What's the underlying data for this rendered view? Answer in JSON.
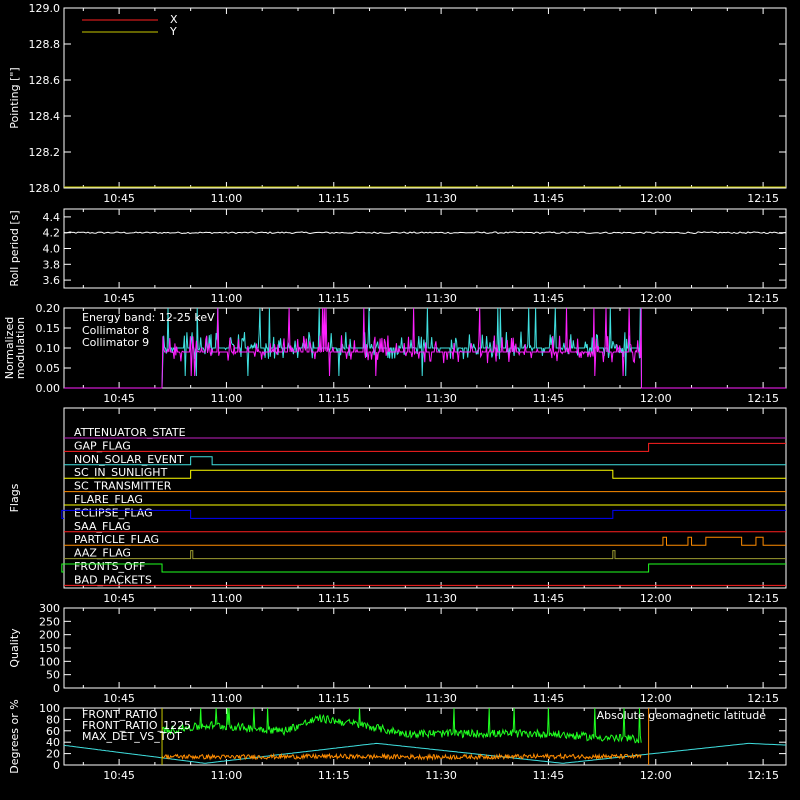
{
  "colors": {
    "background": "#000000",
    "axes": "#ffffff",
    "red": "#ff2020",
    "yellow": "#c8c800",
    "cyan": "#40e0e0",
    "magenta": "#ff20ff",
    "green": "#20ff20",
    "orange": "#ff8c00",
    "blue": "#0000ff",
    "olive": "#9b9b30",
    "purple": "#c020c0",
    "greenyellow": "#c0ff40"
  },
  "time_ticks": [
    "10:45",
    "11:00",
    "11:15",
    "11:30",
    "11:45",
    "12:00",
    "12:15"
  ],
  "chart_data": [
    {
      "id": "pointing",
      "type": "line",
      "ylabel": "Pointing [\"]",
      "ylim": [
        128.0,
        129.0
      ],
      "yticks": [
        "128.0",
        "128.2",
        "128.4",
        "128.6",
        "128.8",
        "129.0"
      ],
      "legend_position": "top-left",
      "series": [
        {
          "name": "X",
          "color": "#ff2020",
          "y": []
        },
        {
          "name": "Y",
          "color": "#c8c800",
          "y": []
        }
      ]
    },
    {
      "id": "roll-period",
      "type": "line",
      "ylabel": "Roll period [s]",
      "ylim": [
        3.5,
        4.5
      ],
      "yticks": [
        "3.6",
        "3.8",
        "4.0",
        "4.2",
        "4.4"
      ],
      "series": [
        {
          "color": "#ffffff",
          "x": [
            "10:37",
            "12:18"
          ],
          "y": [
            4.2,
            4.2
          ]
        }
      ]
    },
    {
      "id": "modulation",
      "type": "line",
      "ylabel": "Normalized modulation",
      "ylim": [
        0.0,
        0.2
      ],
      "yticks": [
        "0.00",
        "0.05",
        "0.10",
        "0.15",
        "0.20"
      ],
      "annotation": "Energy band: 12-25 keV",
      "series": [
        {
          "name": "Collimator 8",
          "color": "#40e0e0",
          "x": [
            "10:37",
            "10:51",
            "10:51",
            "11:58",
            "11:58",
            "12:18"
          ],
          "y": [
            0.0,
            0.0,
            0.1,
            0.1,
            0.0,
            0.0
          ]
        },
        {
          "name": "Collimator 9",
          "color": "#ff20ff",
          "x": [
            "10:37",
            "10:51",
            "10:51",
            "11:58",
            "11:58",
            "12:18"
          ],
          "y": [
            0.0,
            0.0,
            0.09,
            0.09,
            0.0,
            0.0
          ]
        }
      ]
    },
    {
      "id": "flags",
      "type": "line",
      "ylabel": "Flags",
      "flags": [
        {
          "name": "ATTENUATOR_STATE",
          "color": "#c020c0",
          "steps": []
        },
        {
          "name": "GAP_FLAG",
          "color": "#ff2020",
          "steps": [
            [
              "11:59",
              1
            ]
          ]
        },
        {
          "name": "NON_SOLAR_EVENT",
          "color": "#40e0e0",
          "steps": [
            [
              "10:55",
              1
            ],
            [
              "10:58",
              0
            ]
          ]
        },
        {
          "name": "SC_IN_SUNLIGHT",
          "color": "#ffff00",
          "steps": [
            [
              "10:55",
              1
            ],
            [
              "11:54",
              0
            ]
          ]
        },
        {
          "name": "SC_TRANSMITTER",
          "color": "#ff8c00",
          "steps": []
        },
        {
          "name": "FLARE_FLAG",
          "color": "#ffff00",
          "steps": []
        },
        {
          "name": "ECLIPSE_FLAG",
          "color": "#0000ff",
          "steps": [
            [
              "10:37",
              1
            ],
            [
              "10:55",
              0
            ],
            [
              "11:54",
              1
            ]
          ]
        },
        {
          "name": "SAA_FLAG",
          "color": "#ff2020",
          "steps": []
        },
        {
          "name": "PARTICLE_FLAG",
          "color": "#ff8c00",
          "steps": [
            [
              "12:01",
              1
            ],
            [
              "12:01.5",
              0
            ],
            [
              "12:04.5",
              1
            ],
            [
              "12:05",
              0
            ],
            [
              "12:07",
              1
            ],
            [
              "12:12",
              0
            ],
            [
              "12:14",
              1
            ],
            [
              "12:15",
              0
            ]
          ]
        },
        {
          "name": "AAZ_FLAG",
          "color": "#9b9b30",
          "steps": [
            [
              "10:55",
              1
            ],
            [
              "10:55.3",
              0
            ],
            [
              "11:54",
              1
            ],
            [
              "11:54.3",
              0
            ]
          ]
        },
        {
          "name": "FRONTS_OFF",
          "color": "#20ff20",
          "steps": [
            [
              "10:37",
              1
            ],
            [
              "10:51",
              0
            ],
            [
              "11:59",
              1
            ]
          ]
        },
        {
          "name": "BAD_PACKETS",
          "color": "#ff2020",
          "steps": []
        }
      ]
    },
    {
      "id": "quality",
      "type": "line",
      "ylabel": "Quality",
      "ylim": [
        0,
        300
      ],
      "yticks": [
        "0",
        "50",
        "100",
        "150",
        "200",
        "250",
        "300"
      ],
      "series": []
    },
    {
      "id": "front-ratio",
      "type": "line",
      "ylabel": "Degrees or %",
      "ylim": [
        0,
        100
      ],
      "yticks": [
        "0",
        "20",
        "40",
        "60",
        "80",
        "100"
      ],
      "series": [
        {
          "name": "FRONT_RATIO",
          "color": "#ffff00",
          "x": [],
          "y": []
        },
        {
          "name": "FRONT_RATIO_1225",
          "color": "#20ff20",
          "x": [
            "10:51",
            "10:58",
            "11:03",
            "11:08",
            "11:13",
            "11:19",
            "11:25",
            "11:35",
            "11:45",
            "11:50",
            "11:58"
          ],
          "y": [
            60,
            70,
            65,
            60,
            82,
            70,
            55,
            55,
            55,
            50,
            45
          ]
        },
        {
          "name": "MAX_DET_VS_TOT",
          "color": "#ff8c00",
          "x": [
            "10:51",
            "11:00",
            "11:15",
            "11:30",
            "11:45",
            "11:58"
          ],
          "y": [
            15,
            14,
            15,
            14,
            15,
            15
          ]
        },
        {
          "name": "Absolute geomagnetic latitude",
          "color": "#40e0e0",
          "x": [
            "10:37",
            "10:57",
            "11:21",
            "11:47",
            "12:13",
            "12:18"
          ],
          "y": [
            35,
            3,
            38,
            3,
            38,
            35
          ]
        }
      ]
    }
  ]
}
